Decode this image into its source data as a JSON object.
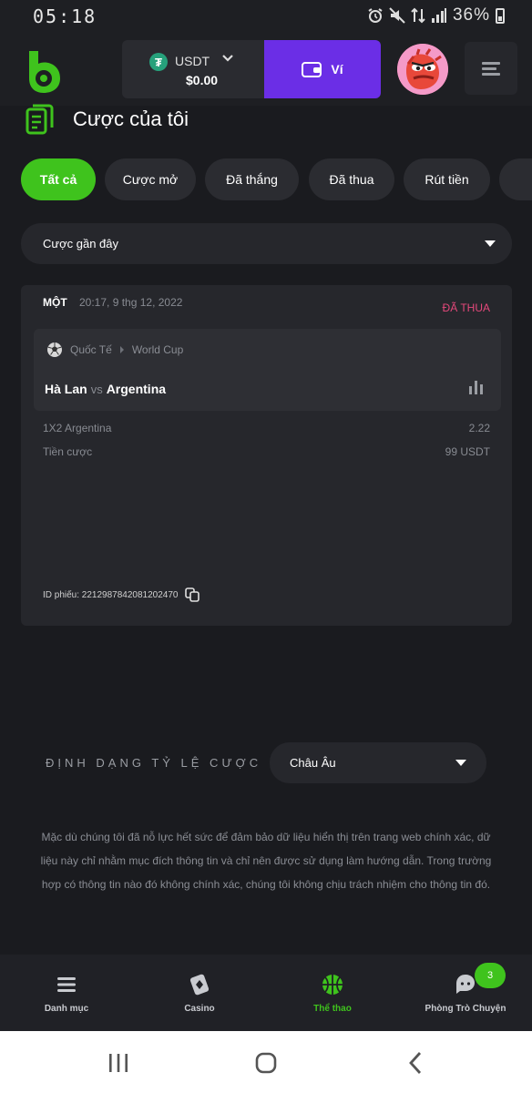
{
  "status_bar": {
    "time": "05:18",
    "battery": "36%"
  },
  "header": {
    "currency": "USDT",
    "currency_icon": "tether-icon",
    "balance": "$0.00",
    "wallet_label": "Ví",
    "accent": "#6b2ee6"
  },
  "page": {
    "title": "Cược của tôi"
  },
  "tabs": [
    {
      "label": "Tất cả",
      "active": true
    },
    {
      "label": "Cược mở",
      "active": false
    },
    {
      "label": "Đã thắng",
      "active": false
    },
    {
      "label": "Đã thua",
      "active": false
    },
    {
      "label": "Rút tiền",
      "active": false
    }
  ],
  "recent_filter": {
    "selected": "Cược gần đây"
  },
  "bet": {
    "type": "MỘT",
    "time": "20:17, 9 thg 12, 2022",
    "status": "ĐÃ THUA",
    "status_color": "#e5487b",
    "category": "Quốc Tế",
    "league": "World Cup",
    "home_team": "Hà Lan",
    "vs": "vs",
    "away_team": "Argentina",
    "market": "1X2 Argentina",
    "odds": "2.22",
    "stake_label": "Tiền cược",
    "stake": "99 USDT",
    "ticket_id": "ID phiếu: 2212987842081202470"
  },
  "odds_format": {
    "label": "ĐỊNH DẠNG TỶ LỆ CƯỢC",
    "selected": "Châu Âu"
  },
  "disclaimer": "Mặc dù chúng tôi đã nỗ lực hết sức để đảm bảo dữ liệu hiển thị trên trang web chính xác, dữ liệu này chỉ nhằm mục đích thông tin và chỉ nên được sử dụng làm hướng dẫn. Trong trường hợp có thông tin nào đó không chính xác, chúng tôi không chịu trách nhiệm cho thông tin đó.",
  "bottom_nav": [
    {
      "label": "Danh mục",
      "icon": "menu-icon"
    },
    {
      "label": "Casino",
      "icon": "casino-icon"
    },
    {
      "label": "Thể thao",
      "icon": "basketball-icon",
      "active": true
    },
    {
      "label": "Phòng Trò Chuyện",
      "icon": "chat-icon"
    }
  ],
  "chat_badge": "3",
  "brand_green": "#3fc31d"
}
